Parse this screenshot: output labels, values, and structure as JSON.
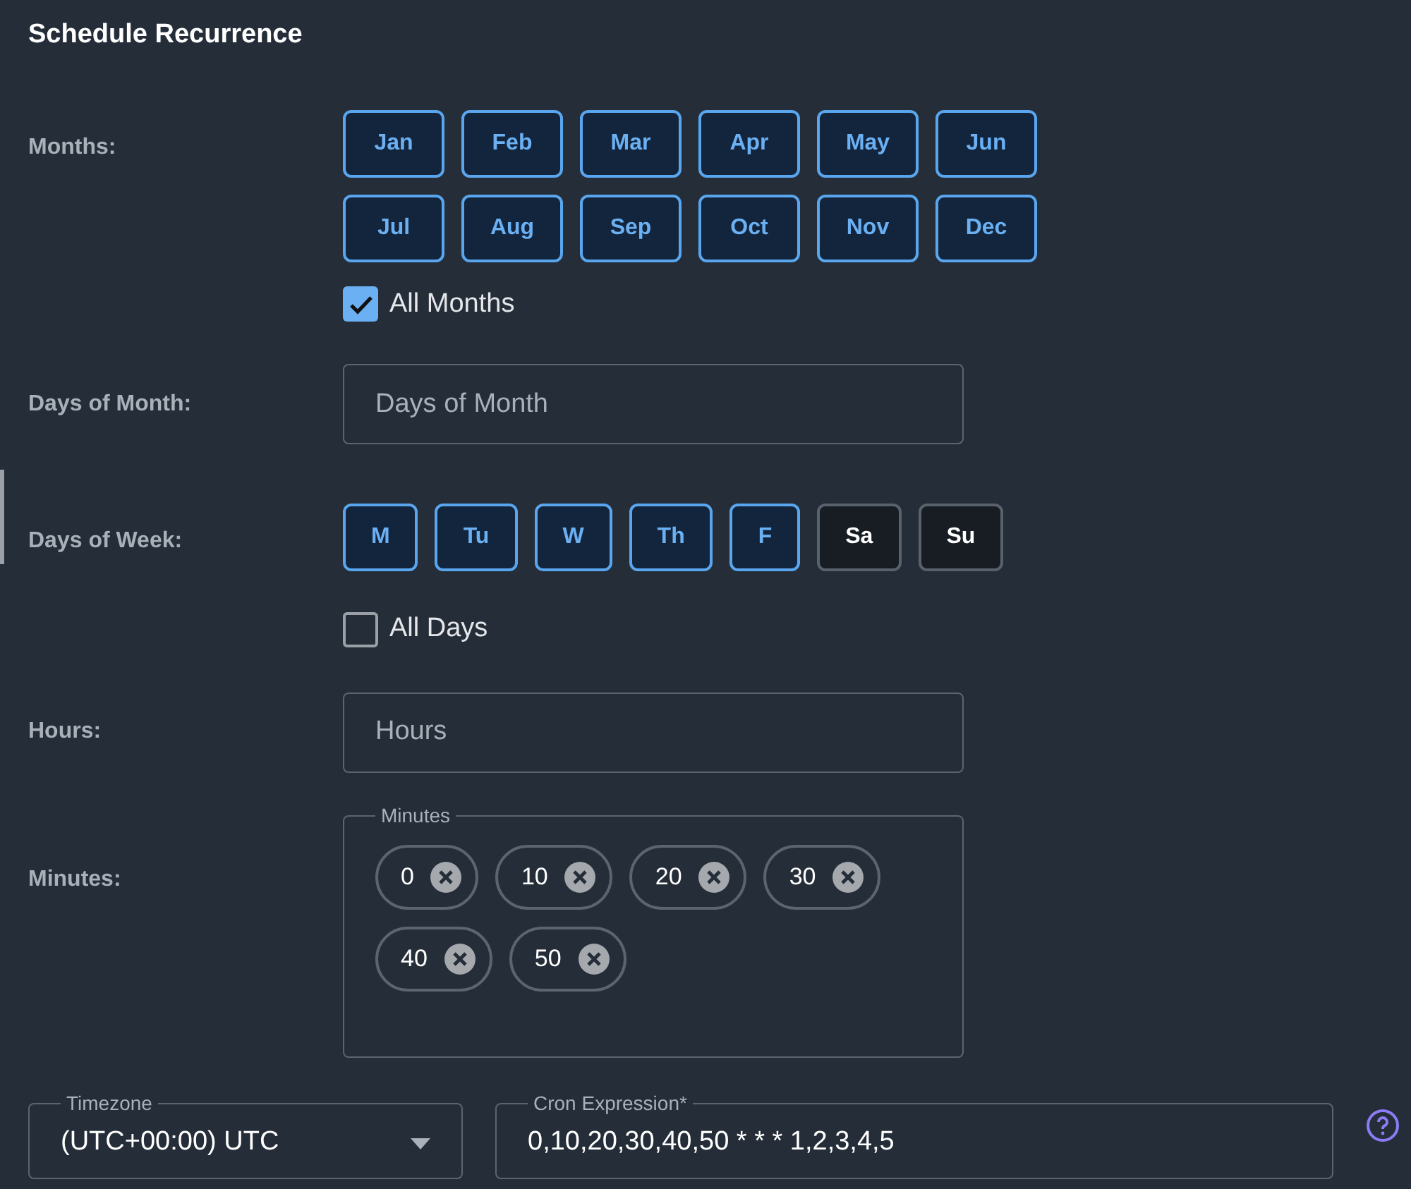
{
  "title": "Schedule Recurrence",
  "months": {
    "label": "Months:",
    "items": [
      {
        "label": "Jan",
        "selected": true
      },
      {
        "label": "Feb",
        "selected": true
      },
      {
        "label": "Mar",
        "selected": true
      },
      {
        "label": "Apr",
        "selected": true
      },
      {
        "label": "May",
        "selected": true
      },
      {
        "label": "Jun",
        "selected": true
      },
      {
        "label": "Jul",
        "selected": true
      },
      {
        "label": "Aug",
        "selected": true
      },
      {
        "label": "Sep",
        "selected": true
      },
      {
        "label": "Oct",
        "selected": true
      },
      {
        "label": "Nov",
        "selected": true
      },
      {
        "label": "Dec",
        "selected": true
      }
    ],
    "all": {
      "label": "All Months",
      "checked": true
    }
  },
  "days_of_month": {
    "label": "Days of Month:",
    "placeholder": "Days of Month"
  },
  "days_of_week": {
    "label": "Days of Week:",
    "items": [
      {
        "label": "M",
        "selected": true
      },
      {
        "label": "Tu",
        "selected": true
      },
      {
        "label": "W",
        "selected": true
      },
      {
        "label": "Th",
        "selected": true
      },
      {
        "label": "F",
        "selected": true
      },
      {
        "label": "Sa",
        "selected": false
      },
      {
        "label": "Su",
        "selected": false
      }
    ],
    "all": {
      "label": "All Days",
      "checked": false
    }
  },
  "hours": {
    "label": "Hours:",
    "placeholder": "Hours"
  },
  "minutes": {
    "label": "Minutes:",
    "legend": "Minutes",
    "chips": [
      "0",
      "10",
      "20",
      "30",
      "40",
      "50"
    ]
  },
  "timezone": {
    "legend": "Timezone",
    "value": "(UTC+00:00) UTC"
  },
  "cron": {
    "legend": "Cron Expression*",
    "value": "0,10,20,30,40,50 * * * 1,2,3,4,5"
  }
}
